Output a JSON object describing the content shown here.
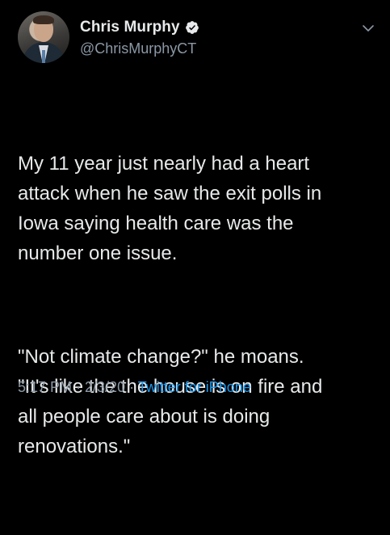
{
  "tweet": {
    "author": {
      "display_name": "Chris Murphy",
      "handle": "@ChrisMurphyCT",
      "verified": true
    },
    "paragraphs": [
      "My 11 year just nearly had a heart\nattack when he saw the exit polls in\nIowa saying health care was the\nnumber one issue.",
      "\"Not climate change?\" he moans.\n\"It's like the the house is on fire and\nall people care about is doing\nrenovations.\""
    ],
    "timestamp": "5:17 PM · 2/3/20 · ",
    "source": "Twitter for iPhone"
  },
  "colors": {
    "background": "#000000",
    "text": "#e7e9ea",
    "secondary": "#8b98a5",
    "link": "#1d9bf0"
  },
  "icons": {
    "verified": "verified-badge-icon",
    "menu": "chevron-down-icon"
  }
}
